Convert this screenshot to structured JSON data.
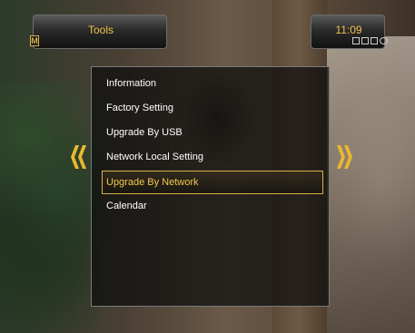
{
  "header": {
    "title": "Tools",
    "menu_badge": "M",
    "clock": "11:09"
  },
  "menu": {
    "items": [
      {
        "label": "Information",
        "selected": false
      },
      {
        "label": "Factory Setting",
        "selected": false
      },
      {
        "label": "Upgrade By USB",
        "selected": false
      },
      {
        "label": "Network Local Setting",
        "selected": false
      },
      {
        "label": "Upgrade By Network",
        "selected": true
      },
      {
        "label": "Calendar",
        "selected": false
      }
    ]
  },
  "nav": {
    "left_icon": "double-chevron-left-icon",
    "right_icon": "double-chevron-right-icon"
  },
  "status_icons": [
    "tv-mode-icon",
    "signal-icon",
    "lock-icon",
    "record-icon"
  ],
  "colors": {
    "accent": "#f0c24a",
    "selection_border": "#d9b04a",
    "text": "#ffffff"
  }
}
